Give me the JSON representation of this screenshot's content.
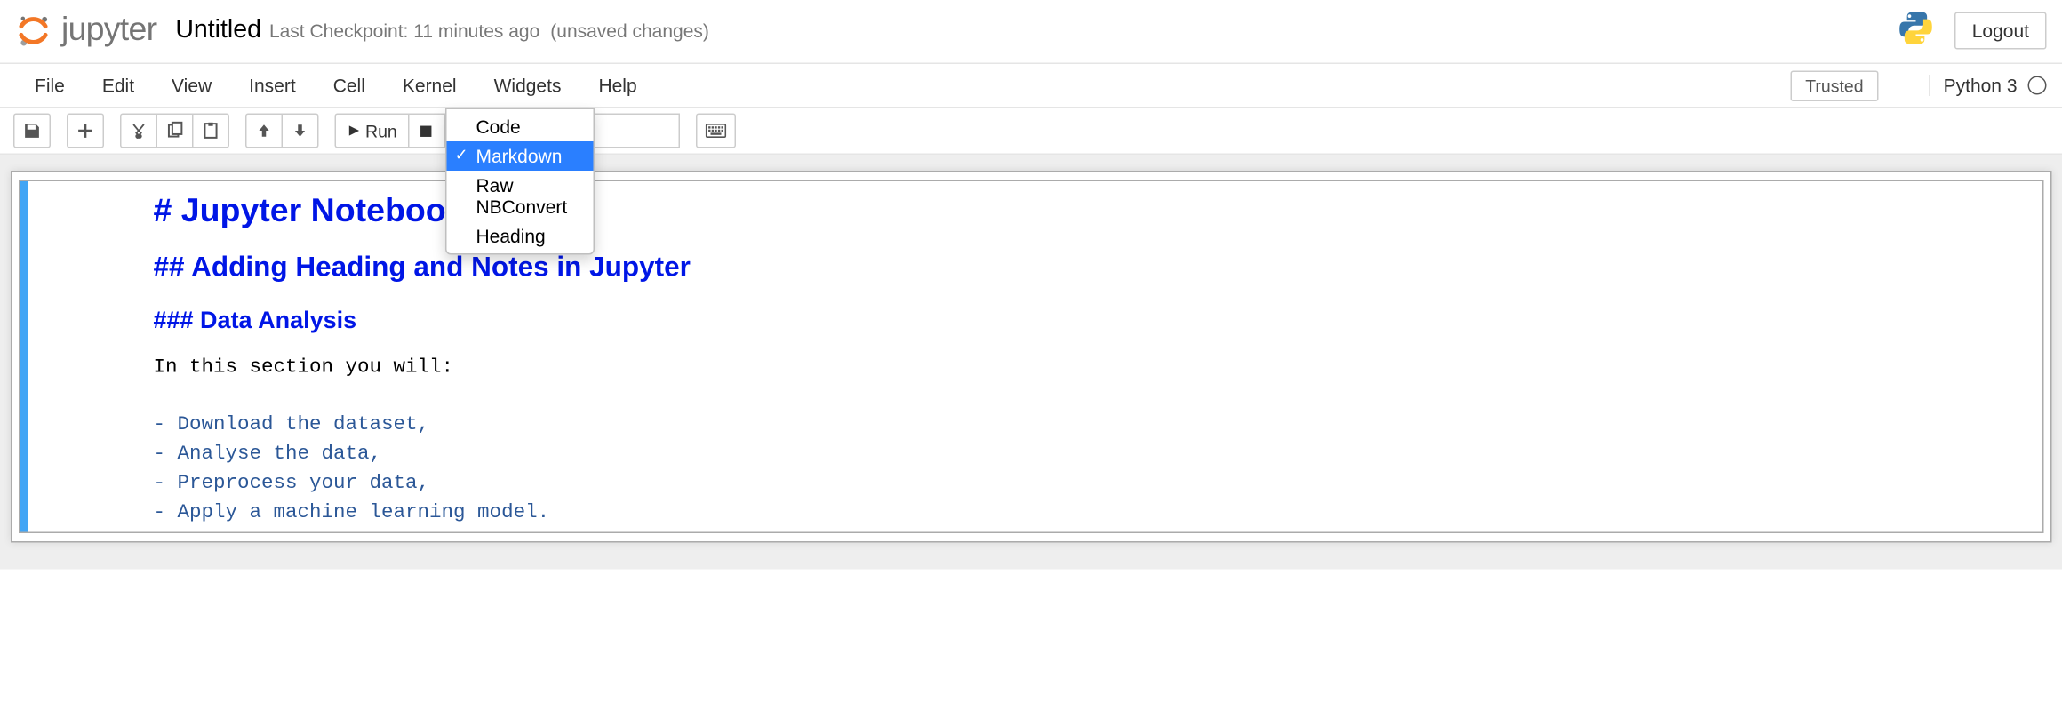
{
  "header": {
    "brand": "jupyter",
    "notebook_name": "Untitled",
    "checkpoint": "Last Checkpoint: 11 minutes ago",
    "unsaved": "(unsaved changes)",
    "logout": "Logout"
  },
  "menubar": {
    "items": [
      "File",
      "Edit",
      "View",
      "Insert",
      "Cell",
      "Kernel",
      "Widgets",
      "Help"
    ],
    "trusted": "Trusted",
    "kernel": "Python 3"
  },
  "toolbar": {
    "run_label": "Run",
    "celltype_selected": "Markdown",
    "celltype_options": [
      "Code",
      "Markdown",
      "Raw NBConvert",
      "Heading"
    ]
  },
  "cell": {
    "h1": "# Jupyter Notebook",
    "h2": "## Adding Heading and Notes in Jupyter",
    "h3": "### Data Analysis",
    "body_intro": "In this section you will:",
    "list": [
      "- Download the dataset,",
      "- Analyse the data,",
      "- Preprocess your data,",
      "- Apply a machine learning model."
    ]
  }
}
